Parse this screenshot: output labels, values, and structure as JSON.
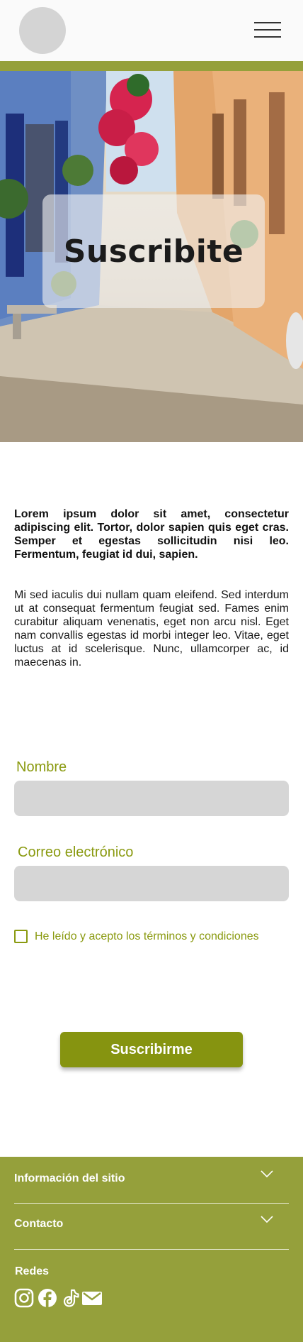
{
  "hero": {
    "title": "Suscribite"
  },
  "content": {
    "intro": "Lorem ipsum dolor sit amet, consectetur adipiscing elit. Tortor, dolor sapien quis eget cras. Semper et egestas sollicitudin nisi leo. Fermentum, feugiat id dui, sapien.",
    "body": "Mi sed iaculis dui nullam quam eleifend. Sed interdum ut at consequat fermentum feugiat sed. Fames enim curabitur aliquam venenatis, eget non arcu nisl. Eget nam convallis egestas id morbi integer leo. Vitae, eget luctus at id scelerisque. Nunc, ullamcorper ac, id maecenas in."
  },
  "form": {
    "name_label": "Nombre",
    "name_value": "",
    "email_label": "Correo electrónico",
    "email_value": "",
    "terms_label": "He leído y acepto los términos y condiciones",
    "terms_checked": false,
    "submit_label": "Suscribirme"
  },
  "footer": {
    "site_info_label": "Información del sitio",
    "contact_label": "Contacto",
    "social_title": "Redes",
    "social_icons": [
      "instagram-icon",
      "facebook-icon",
      "tiktok-icon",
      "mail-icon"
    ]
  },
  "colors": {
    "accent": "#95a03b",
    "button": "#869410",
    "label_text": "#8a9a10",
    "field_bg": "#d6d6d6",
    "logo_placeholder": "#d4d4d4"
  }
}
